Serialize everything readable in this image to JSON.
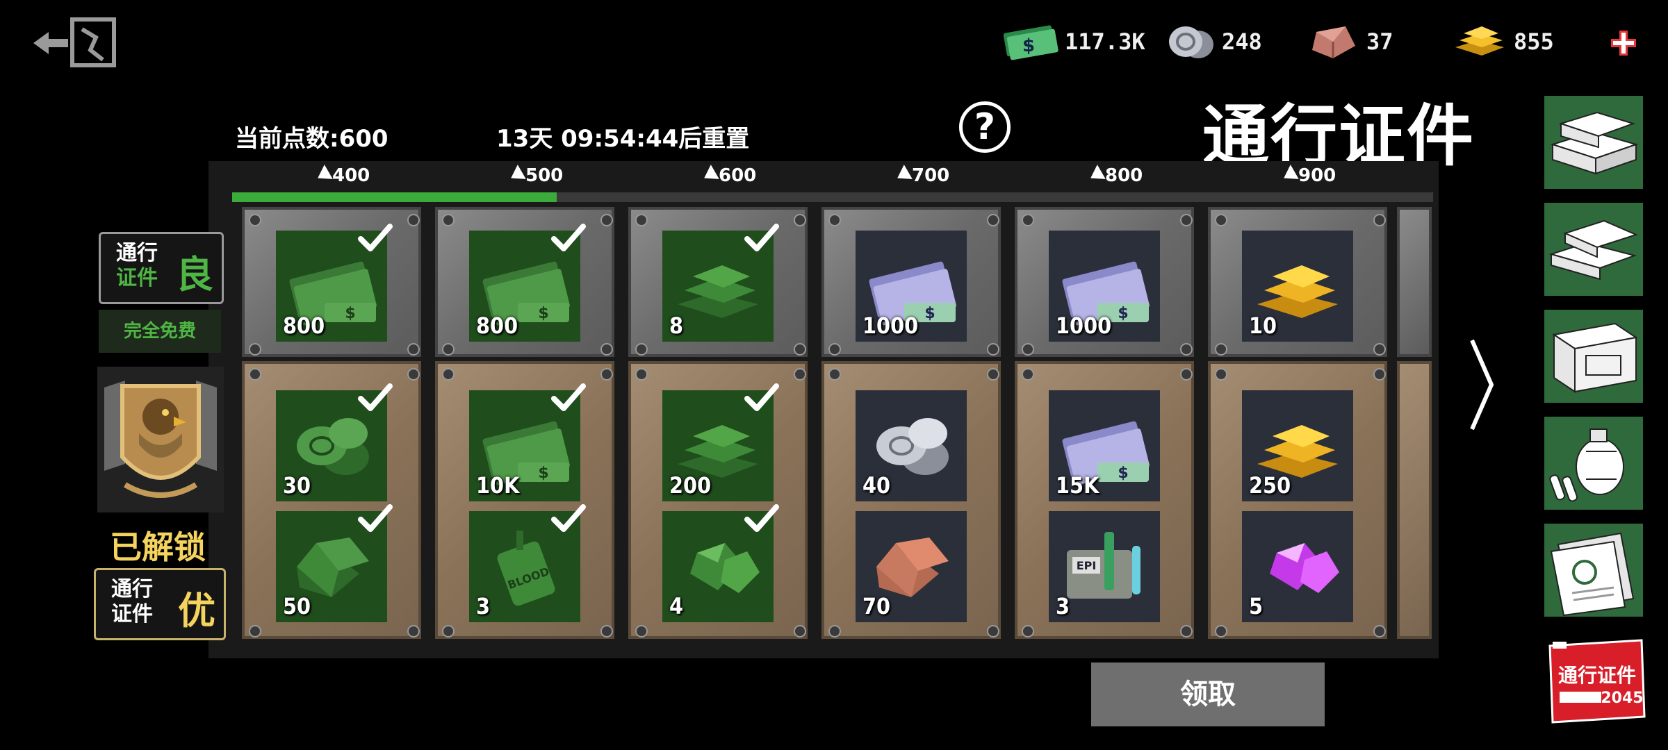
{
  "header": {
    "points_text": "当前点数:600",
    "timer_text": "13天 09:54:44后重置",
    "help_label": "?",
    "title": "通行证件"
  },
  "resources": [
    {
      "name": "cash",
      "icon": "cash-icon",
      "value": "117.3K"
    },
    {
      "name": "silver-coins",
      "icon": "silver-coin-icon",
      "value": "248"
    },
    {
      "name": "copper-crystal",
      "icon": "copper-crystal-icon",
      "value": "37"
    },
    {
      "name": "gold-bars",
      "icon": "gold-bar-icon",
      "value": "855"
    }
  ],
  "milestones": [
    "400",
    "500",
    "600",
    "700",
    "800",
    "900"
  ],
  "progress": {
    "current": 600,
    "fraction": 0.27
  },
  "tiers": {
    "free": {
      "line1": "通行",
      "line2": "证件",
      "grade": "良",
      "badge": "完全免费"
    },
    "premium": {
      "line1": "通行",
      "line2": "证件",
      "grade": "优",
      "status": "已解锁"
    }
  },
  "columns": [
    {
      "milestone": "400",
      "claimed": true,
      "free": {
        "icon": "cash-icon",
        "qty": "800"
      },
      "pro": [
        {
          "icon": "coin-icon",
          "qty": "30"
        },
        {
          "icon": "crystal-icon",
          "qty": "50"
        }
      ]
    },
    {
      "milestone": "500",
      "claimed": true,
      "free": {
        "icon": "cash-icon",
        "qty": "800"
      },
      "pro": [
        {
          "icon": "cash-icon",
          "qty": "10K"
        },
        {
          "icon": "blood-pack-icon",
          "qty": "3"
        }
      ]
    },
    {
      "milestone": "600",
      "claimed": true,
      "free": {
        "icon": "gold-bar-icon",
        "qty": "8"
      },
      "pro": [
        {
          "icon": "gold-bar-icon",
          "qty": "200"
        },
        {
          "icon": "gem-icon",
          "qty": "4"
        }
      ]
    },
    {
      "milestone": "700",
      "claimed": false,
      "free": {
        "icon": "cash-icon",
        "qty": "1000"
      },
      "pro": [
        {
          "icon": "silver-coin-icon",
          "qty": "40"
        },
        {
          "icon": "copper-crystal-icon",
          "qty": "70"
        }
      ]
    },
    {
      "milestone": "800",
      "claimed": false,
      "free": {
        "icon": "cash-icon",
        "qty": "1000"
      },
      "pro": [
        {
          "icon": "cash-icon",
          "qty": "15K"
        },
        {
          "icon": "epi-kit-icon",
          "qty": "3"
        }
      ]
    },
    {
      "milestone": "900",
      "claimed": false,
      "free": {
        "icon": "gold-bar-icon",
        "qty": "10"
      },
      "pro": [
        {
          "icon": "gold-bar-icon",
          "qty": "250"
        },
        {
          "icon": "purple-gem-icon",
          "qty": "5"
        }
      ]
    }
  ],
  "sidebar": [
    {
      "icon": "gold-bars-stack-icon"
    },
    {
      "icon": "cash-stack-icon"
    },
    {
      "icon": "supply-crate-icon"
    },
    {
      "icon": "grenade-ammo-icon"
    },
    {
      "icon": "documents-icon"
    }
  ],
  "pass_badge": {
    "line1": "通行证件",
    "line2": "2045"
  },
  "claim_label": "领取",
  "colors": {
    "progress": "#3bab3b",
    "free_gold": "#4fb544",
    "premium_gold": "#f4d35e"
  }
}
